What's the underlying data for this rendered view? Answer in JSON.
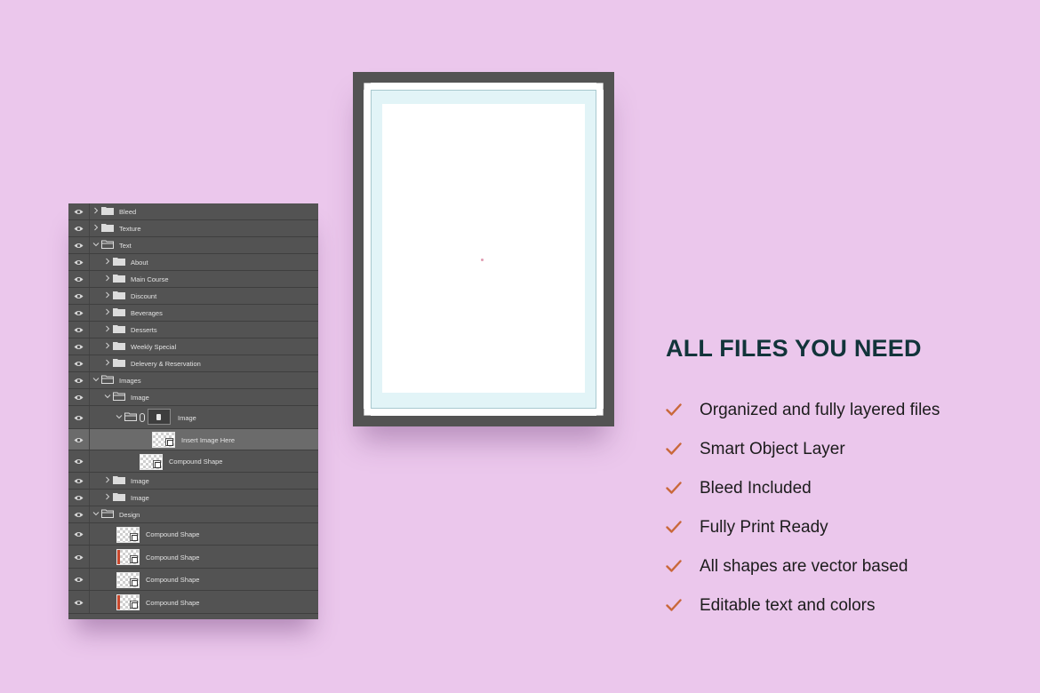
{
  "layers_panel": {
    "rows": [
      {
        "label": "Bleed",
        "type": "folder",
        "expanded": false,
        "indent": 0
      },
      {
        "label": "Texture",
        "type": "folder",
        "expanded": false,
        "indent": 0
      },
      {
        "label": "Text",
        "type": "folder",
        "expanded": true,
        "indent": 0
      },
      {
        "label": "About",
        "type": "folder",
        "expanded": false,
        "indent": 1
      },
      {
        "label": "Main Course",
        "type": "folder",
        "expanded": false,
        "indent": 1
      },
      {
        "label": "Discount",
        "type": "folder",
        "expanded": false,
        "indent": 1
      },
      {
        "label": "Beverages",
        "type": "folder",
        "expanded": false,
        "indent": 1
      },
      {
        "label": "Desserts",
        "type": "folder",
        "expanded": false,
        "indent": 1
      },
      {
        "label": "Weekly Special",
        "type": "folder",
        "expanded": false,
        "indent": 1
      },
      {
        "label": "Delevery & Reservation",
        "type": "folder",
        "expanded": false,
        "indent": 1
      },
      {
        "label": "Images",
        "type": "folder",
        "expanded": true,
        "indent": 0
      },
      {
        "label": "Image",
        "type": "folder",
        "expanded": true,
        "indent": 1
      },
      {
        "label": "Image",
        "type": "masked-folder",
        "expanded": true,
        "indent": 2
      },
      {
        "label": "Insert Image Here",
        "type": "smart-object",
        "indent": 3,
        "selected": true
      },
      {
        "label": "Compound Shape",
        "type": "shape",
        "indent": 3
      },
      {
        "label": "Image",
        "type": "folder",
        "expanded": false,
        "indent": 1
      },
      {
        "label": "Image",
        "type": "folder",
        "expanded": false,
        "indent": 1
      },
      {
        "label": "Design",
        "type": "folder",
        "expanded": true,
        "indent": 0
      },
      {
        "label": "Compound Shape",
        "type": "shape",
        "indent": 1
      },
      {
        "label": "Compound Shape",
        "type": "shape",
        "indent": 1,
        "red_edge": true
      },
      {
        "label": "Compound Shape",
        "type": "shape",
        "indent": 1
      },
      {
        "label": "Compound Shape",
        "type": "shape",
        "indent": 1,
        "red_edge": true
      }
    ]
  },
  "heading": "ALL FILES YOU NEED",
  "features": [
    "Organized and fully layered files",
    "Smart Object Layer",
    "Bleed Included",
    "Fully Print Ready",
    "All shapes are vector based",
    "Editable text and colors"
  ],
  "colors": {
    "background": "#ebc7ec",
    "heading": "#12343a",
    "check": "#c9683a",
    "panel": "#535353",
    "bleed_area": "#e2f4f7"
  }
}
